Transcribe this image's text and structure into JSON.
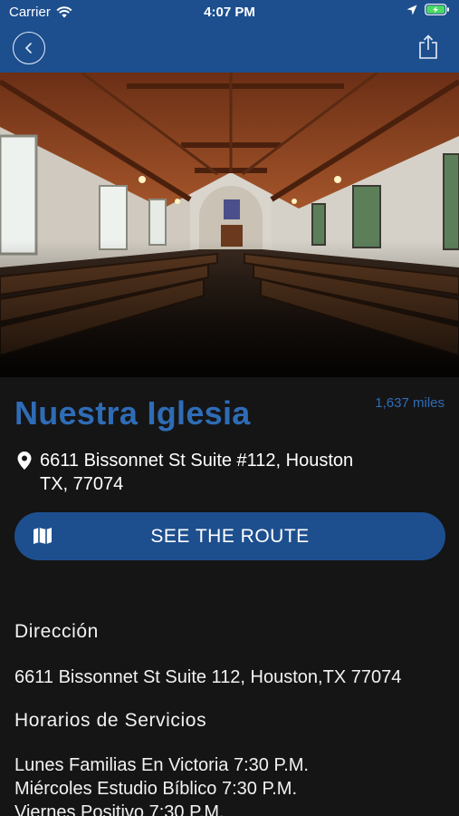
{
  "status_bar": {
    "carrier": "Carrier",
    "time": "4:07 PM"
  },
  "header": {
    "back_icon": "chevron-left-icon",
    "share_icon": "share-icon",
    "color": "#1d4f8f"
  },
  "church": {
    "name": "Nuestra Iglesia",
    "distance": "1,637 miles",
    "address_line1": "6611 Bissonnet St Suite #112, Houston",
    "address_line2": "TX, 77074"
  },
  "route_button": {
    "label": "SEE THE ROUTE",
    "icon": "map-icon"
  },
  "details": {
    "direccion_label": "Dirección",
    "direccion_value": "6611 Bissonnet St Suite 112, Houston,TX 77074",
    "horarios_label": "Horarios de Servicios",
    "services": [
      "Lunes Familias En Victoria 7:30 P.M.",
      "Miércoles Estudio Bíblico 7:30 P.M.",
      "Viernes Positivo 7:30 P.M."
    ]
  },
  "colors": {
    "accent": "#2f6cb6",
    "background": "#151515"
  }
}
